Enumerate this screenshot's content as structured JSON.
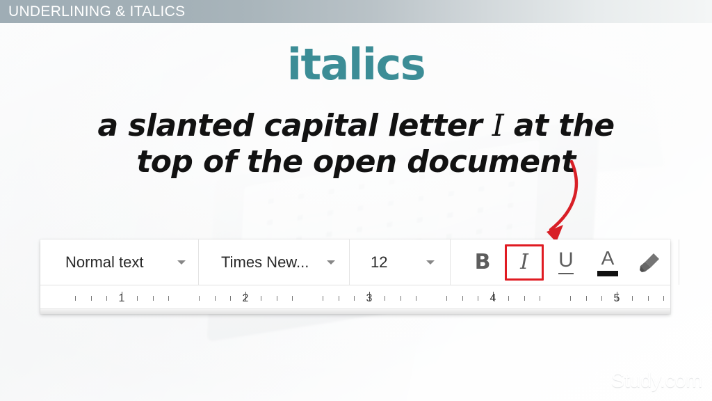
{
  "header": {
    "title": "UNDERLINING & ITALICS",
    "bar_color": "#a3b0b7",
    "text_color": "#ffffff"
  },
  "content": {
    "keyword": "italics",
    "keyword_color": "#3c8d96",
    "definition_line1_before": "a slanted capital letter ",
    "definition_italic_letter": "I",
    "definition_line1_after": " at the",
    "definition_line2": "top of the open document",
    "definition_color": "#121212"
  },
  "annotation": {
    "arrow_name": "red-curved-arrow",
    "arrow_color": "#d81f26",
    "points_to": "italic-button"
  },
  "toolbar": {
    "style_select": {
      "value": "Normal text",
      "caret": "chevron-down-icon"
    },
    "font_select": {
      "value": "Times New...",
      "caret": "chevron-down-icon"
    },
    "size_select": {
      "value": "12",
      "caret": "chevron-down-icon"
    },
    "buttons": [
      {
        "name": "bold-button",
        "glyph": "B",
        "active": false
      },
      {
        "name": "italic-button",
        "glyph": "I",
        "active": true
      },
      {
        "name": "underline-button",
        "glyph": "U",
        "active": false
      },
      {
        "name": "text-color-button",
        "glyph": "A",
        "active": false,
        "swatch_color": "#111111"
      },
      {
        "name": "highlight-button",
        "glyph": "pen-icon",
        "active": false
      }
    ],
    "highlight_color": "#e01b22"
  },
  "ruler": {
    "numbers": [
      "1",
      "2",
      "3",
      "4",
      "5"
    ],
    "unit": "inch"
  },
  "watermark": {
    "text": "Study.com",
    "icon": "play-circle-icon"
  }
}
